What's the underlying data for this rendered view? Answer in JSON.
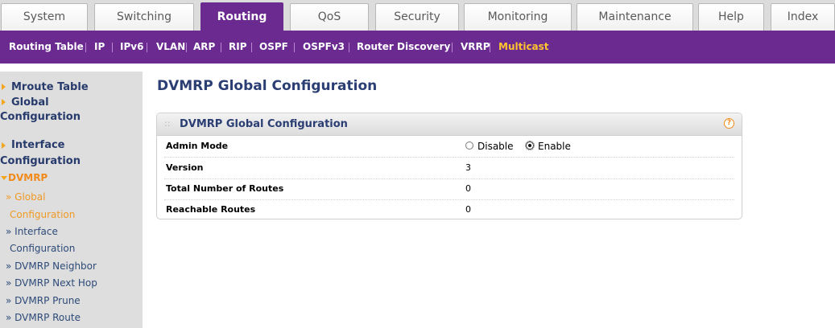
{
  "tabs": [
    {
      "label": "System"
    },
    {
      "label": "Switching"
    },
    {
      "label": "Routing",
      "active": true
    },
    {
      "label": "QoS"
    },
    {
      "label": "Security"
    },
    {
      "label": "Monitoring"
    },
    {
      "label": "Maintenance"
    },
    {
      "label": "Help"
    },
    {
      "label": "Index"
    }
  ],
  "subnav": [
    {
      "label": "Routing Table"
    },
    {
      "label": "IP"
    },
    {
      "label": "IPv6"
    },
    {
      "label": "VLAN"
    },
    {
      "label": "ARP"
    },
    {
      "label": "RIP"
    },
    {
      "label": "OSPF"
    },
    {
      "label": "OSPFv3"
    },
    {
      "label": "Router Discovery"
    },
    {
      "label": "VRRP"
    },
    {
      "label": "Multicast",
      "active": true
    }
  ],
  "sidebar": {
    "mroute_table": "Mroute Table",
    "global_config_1": "Global",
    "global_config_2": "Configuration",
    "interface_config_1": "Interface",
    "interface_config_2": "Configuration",
    "dvmrp": "DVMRP",
    "sub_global_1": "» Global",
    "sub_global_2": "Configuration",
    "sub_interface_1": "» Interface",
    "sub_interface_2": "Configuration",
    "sub_neighbor": "» DVMRP Neighbor",
    "sub_nexthop": "» DVMRP Next Hop",
    "sub_prune": "» DVMRP Prune",
    "sub_route": "» DVMRP Route"
  },
  "main": {
    "page_title": "DVMRP Global Configuration",
    "panel_title": "DVMRP Global Configuration",
    "grip": "::",
    "help_icon": "?",
    "admin_mode_label": "Admin Mode",
    "admin_mode_options": {
      "disable": "Disable",
      "enable": "Enable"
    },
    "admin_mode_selected": "Enable",
    "version_label": "Version",
    "version_value": "3",
    "total_routes_label": "Total Number of Routes",
    "total_routes_value": "0",
    "reachable_label": "Reachable Routes",
    "reachable_value": "0"
  },
  "colors": {
    "accent": "#6a2a90",
    "active_text": "#ffc42e",
    "sidebar_orange": "#f08a1a",
    "heading": "#2b3e73"
  }
}
